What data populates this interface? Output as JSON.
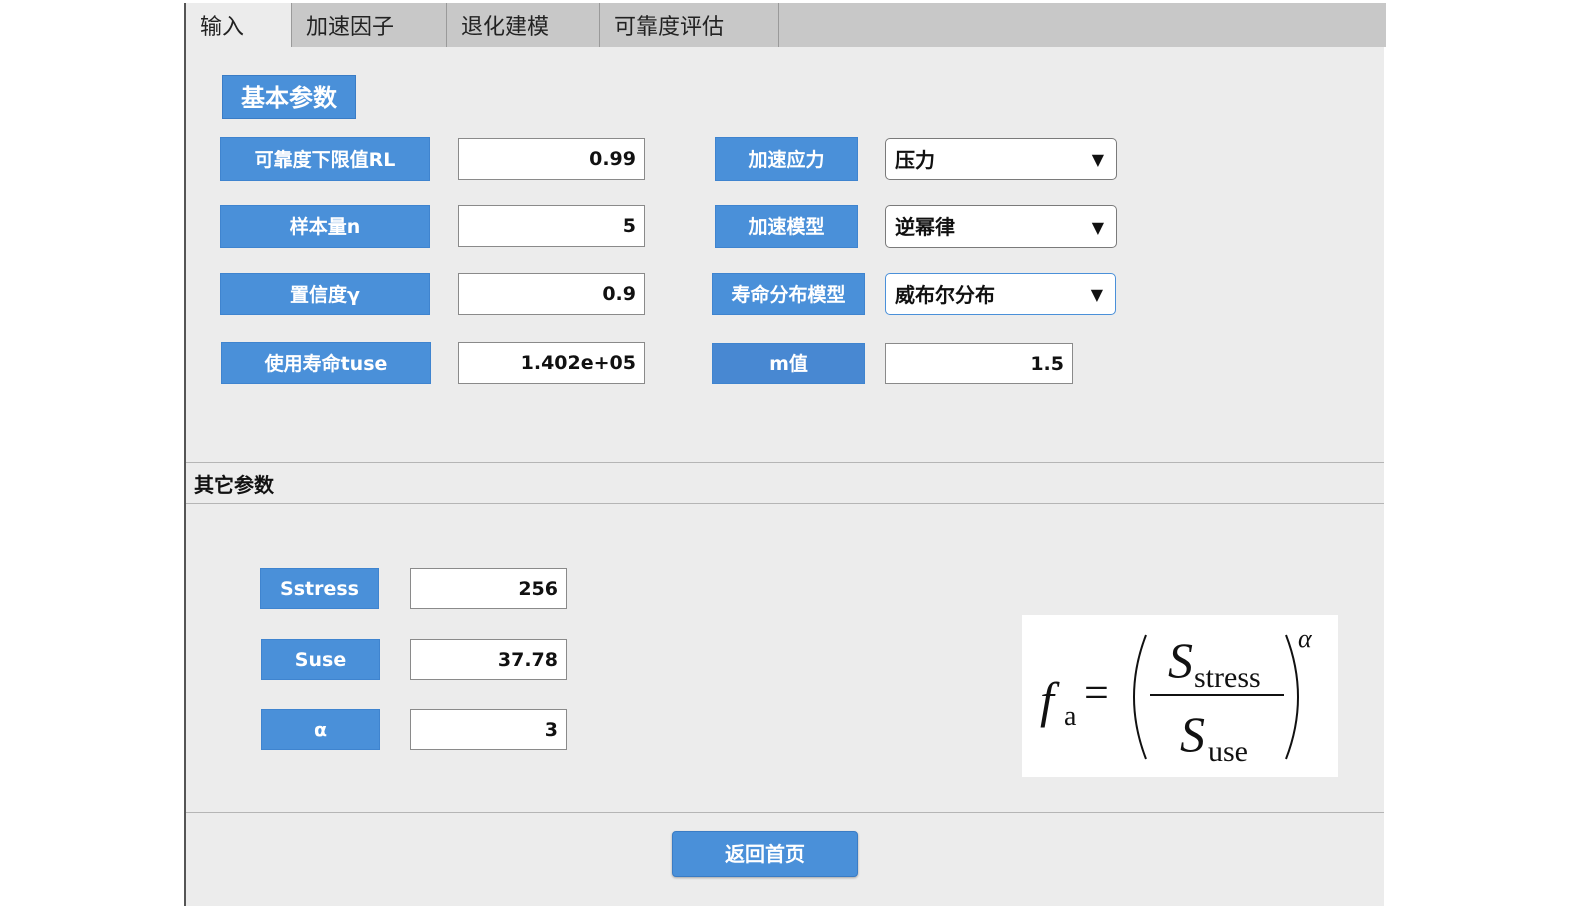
{
  "tabs": [
    {
      "label": "输入"
    },
    {
      "label": "加速因子"
    },
    {
      "label": "退化建模"
    },
    {
      "label": "可靠度评估"
    }
  ],
  "basic": {
    "title": "基本参数",
    "reliability_lower_label": "可靠度下限值RL",
    "reliability_lower_value": "0.99",
    "sample_size_label": "样本量n",
    "sample_size_value": "5",
    "confidence_label": "置信度γ",
    "confidence_value": "0.9",
    "use_life_label": "使用寿命tuse",
    "use_life_value": "1.402e+05",
    "accel_stress_label": "加速应力",
    "accel_stress_value": "压力",
    "accel_model_label": "加速模型",
    "accel_model_value": "逆幂律",
    "life_dist_label": "寿命分布模型",
    "life_dist_value": "威布尔分布",
    "m_label": "m值",
    "m_value": "1.5",
    "dropdown_arrow": "▼"
  },
  "other": {
    "title": "其它参数",
    "sstress_label": "Sstress",
    "sstress_value": "256",
    "suse_label": "Suse",
    "suse_value": "37.78",
    "alpha_label": "α",
    "alpha_value": "3"
  },
  "formula": {
    "lhs": "f",
    "lhs_sub": "a",
    "equals": "=",
    "num": "S",
    "num_sub": "stress",
    "den": "S",
    "den_sub": "use",
    "exp": "α"
  },
  "footer": {
    "back_label": "返回首页"
  }
}
